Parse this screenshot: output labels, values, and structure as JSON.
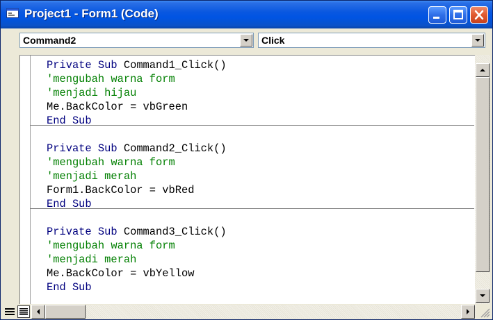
{
  "window": {
    "title": "Project1 - Form1 (Code)",
    "icon": "vb-form-icon"
  },
  "controls": {
    "minimize_icon": "minimize-icon",
    "maximize_icon": "maximize-icon",
    "close_icon": "close-icon"
  },
  "object_combo": {
    "value": "Command2"
  },
  "procedure_combo": {
    "value": "Click"
  },
  "code": {
    "procedures": [
      {
        "lines": [
          {
            "parts": [
              {
                "type": "kw",
                "text": "Private Sub "
              },
              {
                "type": "tx",
                "text": "Command1_Click()"
              }
            ]
          },
          {
            "parts": [
              {
                "type": "cm",
                "text": "'mengubah warna form"
              }
            ]
          },
          {
            "parts": [
              {
                "type": "cm",
                "text": "'menjadi hijau"
              }
            ]
          },
          {
            "parts": [
              {
                "type": "tx",
                "text": "Me.BackColor = vbGreen"
              }
            ]
          },
          {
            "parts": [
              {
                "type": "kw",
                "text": "End Sub"
              }
            ]
          }
        ]
      },
      {
        "lines": [
          {
            "parts": [
              {
                "type": "kw",
                "text": "Private Sub "
              },
              {
                "type": "tx",
                "text": "Command2_Click()"
              }
            ]
          },
          {
            "parts": [
              {
                "type": "cm",
                "text": "'mengubah warna form"
              }
            ]
          },
          {
            "parts": [
              {
                "type": "cm",
                "text": "'menjadi merah"
              }
            ]
          },
          {
            "parts": [
              {
                "type": "tx",
                "text": "Form1.BackColor = vbRed"
              }
            ]
          },
          {
            "parts": [
              {
                "type": "kw",
                "text": "End Sub"
              }
            ]
          }
        ]
      },
      {
        "lines": [
          {
            "parts": [
              {
                "type": "kw",
                "text": "Private Sub "
              },
              {
                "type": "tx",
                "text": "Command3_Click()"
              }
            ]
          },
          {
            "parts": [
              {
                "type": "cm",
                "text": "'mengubah warna form"
              }
            ]
          },
          {
            "parts": [
              {
                "type": "cm",
                "text": "'menjadi merah"
              }
            ]
          },
          {
            "parts": [
              {
                "type": "tx",
                "text": "Me.BackColor = vbYellow"
              }
            ]
          },
          {
            "parts": [
              {
                "type": "kw",
                "text": "End Sub"
              }
            ]
          }
        ]
      }
    ]
  },
  "colors": {
    "keyword": "#00007f",
    "comment": "#007f00",
    "text": "#000000",
    "titlebar": "#0054e3"
  }
}
